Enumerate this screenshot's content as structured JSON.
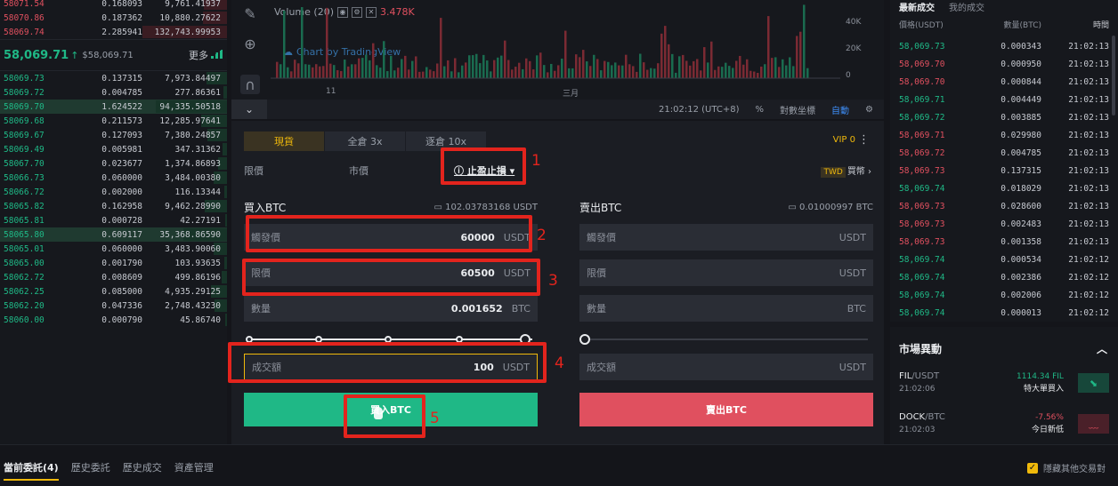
{
  "orderbook": {
    "asks": [
      {
        "price": "58071.54",
        "amount": "0.168093",
        "total": "9,761.41937"
      },
      {
        "price": "58070.86",
        "amount": "0.187362",
        "total": "10,880.27622"
      },
      {
        "price": "58069.74",
        "amount": "2.285941",
        "total": "132,743.99953"
      }
    ],
    "last_price": "58,069.71",
    "mark_price": "$58,069.71",
    "more_label": "更多",
    "bids": [
      {
        "price": "58069.73",
        "amount": "0.137315",
        "total": "7,973.84497"
      },
      {
        "price": "58069.72",
        "amount": "0.004785",
        "total": "277.86361"
      },
      {
        "price": "58069.70",
        "amount": "1.624522",
        "total": "94,335.50518"
      },
      {
        "price": "58069.68",
        "amount": "0.211573",
        "total": "12,285.97641"
      },
      {
        "price": "58069.67",
        "amount": "0.127093",
        "total": "7,380.24857"
      },
      {
        "price": "58069.49",
        "amount": "0.005981",
        "total": "347.31362"
      },
      {
        "price": "58067.70",
        "amount": "0.023677",
        "total": "1,374.86893"
      },
      {
        "price": "58066.73",
        "amount": "0.060000",
        "total": "3,484.00380"
      },
      {
        "price": "58066.72",
        "amount": "0.002000",
        "total": "116.13344"
      },
      {
        "price": "58065.82",
        "amount": "0.162958",
        "total": "9,462.28990"
      },
      {
        "price": "58065.81",
        "amount": "0.000728",
        "total": "42.27191"
      },
      {
        "price": "58065.80",
        "amount": "0.609117",
        "total": "35,368.86590"
      },
      {
        "price": "58065.01",
        "amount": "0.060000",
        "total": "3,483.90060"
      },
      {
        "price": "58065.00",
        "amount": "0.001790",
        "total": "103.93635"
      },
      {
        "price": "58062.72",
        "amount": "0.008609",
        "total": "499.86196"
      },
      {
        "price": "58062.25",
        "amount": "0.085000",
        "total": "4,935.29125"
      },
      {
        "price": "58062.20",
        "amount": "0.047336",
        "total": "2,748.43230"
      },
      {
        "price": "58060.00",
        "amount": "0.000790",
        "total": "45.86740"
      }
    ]
  },
  "chart": {
    "volume_label": "Volume (20)",
    "volume_value": "3.478K",
    "tv_label": "Chart by TradingView",
    "y_ticks": [
      "40K",
      "20K",
      "0"
    ],
    "x_ticks": [
      "11",
      "三月"
    ],
    "time": "21:02:12 (UTC+8)",
    "percent": "%",
    "log": "對數坐標",
    "auto": "自動"
  },
  "trade": {
    "tabs": [
      "現貨",
      "全倉 3x",
      "逐倉 10x"
    ],
    "vip": "VIP 0",
    "order_types": [
      "限價",
      "市價",
      "止盈止損"
    ],
    "twd_badge": "TWD",
    "twd_label": "買幣",
    "buy": {
      "title": "買入BTC",
      "available": "102.03783168 USDT",
      "stop_label": "觸發價",
      "stop_value": "60000",
      "stop_unit": "USDT",
      "limit_label": "限價",
      "limit_value": "60500",
      "limit_unit": "USDT",
      "amount_label": "數量",
      "amount_value": "0.001652",
      "amount_unit": "BTC",
      "total_label": "成交額",
      "total_value": "100",
      "total_unit": "USDT",
      "button": "買入BTC"
    },
    "sell": {
      "title": "賣出BTC",
      "available": "0.01000997 BTC",
      "stop_label": "觸發價",
      "stop_unit": "USDT",
      "limit_label": "限價",
      "limit_unit": "USDT",
      "amount_label": "數量",
      "amount_unit": "BTC",
      "total_label": "成交額",
      "total_unit": "USDT",
      "button": "賣出BTC"
    }
  },
  "trades": {
    "tabs": [
      "最新成交",
      "我的成交"
    ],
    "cols": [
      "價格(USDT)",
      "數量(BTC)",
      "時間"
    ],
    "rows": [
      {
        "price": "58,069.73",
        "dir": "up",
        "qty": "0.000343",
        "time": "21:02:13"
      },
      {
        "price": "58,069.70",
        "dir": "dn",
        "qty": "0.000950",
        "time": "21:02:13"
      },
      {
        "price": "58,069.70",
        "dir": "dn",
        "qty": "0.000844",
        "time": "21:02:13"
      },
      {
        "price": "58,069.71",
        "dir": "up",
        "qty": "0.004449",
        "time": "21:02:13"
      },
      {
        "price": "58,069.72",
        "dir": "up",
        "qty": "0.003885",
        "time": "21:02:13"
      },
      {
        "price": "58,069.71",
        "dir": "dn",
        "qty": "0.029980",
        "time": "21:02:13"
      },
      {
        "price": "58,069.72",
        "dir": "dn",
        "qty": "0.004785",
        "time": "21:02:13"
      },
      {
        "price": "58,069.73",
        "dir": "dn",
        "qty": "0.137315",
        "time": "21:02:13"
      },
      {
        "price": "58,069.74",
        "dir": "up",
        "qty": "0.018029",
        "time": "21:02:13"
      },
      {
        "price": "58,069.73",
        "dir": "dn",
        "qty": "0.028600",
        "time": "21:02:13"
      },
      {
        "price": "58,069.73",
        "dir": "dn",
        "qty": "0.002483",
        "time": "21:02:13"
      },
      {
        "price": "58,069.73",
        "dir": "dn",
        "qty": "0.001358",
        "time": "21:02:13"
      },
      {
        "price": "58,069.74",
        "dir": "up",
        "qty": "0.000534",
        "time": "21:02:12"
      },
      {
        "price": "58,069.74",
        "dir": "up",
        "qty": "0.002386",
        "time": "21:02:12"
      },
      {
        "price": "58,069.74",
        "dir": "up",
        "qty": "0.002006",
        "time": "21:02:12"
      },
      {
        "price": "58,069.74",
        "dir": "up",
        "qty": "0.000013",
        "time": "21:02:12"
      }
    ]
  },
  "movers": {
    "title": "市場異動",
    "items": [
      {
        "base": "FIL",
        "quote": "/USDT",
        "time": "21:02:06",
        "value": "1114.34 FIL",
        "label": "特大單買入",
        "dir": "up"
      },
      {
        "base": "DOCK",
        "quote": "/BTC",
        "time": "21:02:03",
        "value": "-7.56%",
        "label": "今日新低",
        "dir": "dn"
      }
    ]
  },
  "bottom": {
    "tabs": [
      "當前委託(4)",
      "歷史委託",
      "歷史成交",
      "資產管理"
    ],
    "hide_others": "隱藏其他交易對"
  },
  "annotations": [
    "1",
    "2",
    "3",
    "4",
    "5"
  ],
  "colors": {
    "up": "#1fb886",
    "down": "#e0505f",
    "accent": "#f0b90b",
    "annotation": "#e3241d"
  }
}
